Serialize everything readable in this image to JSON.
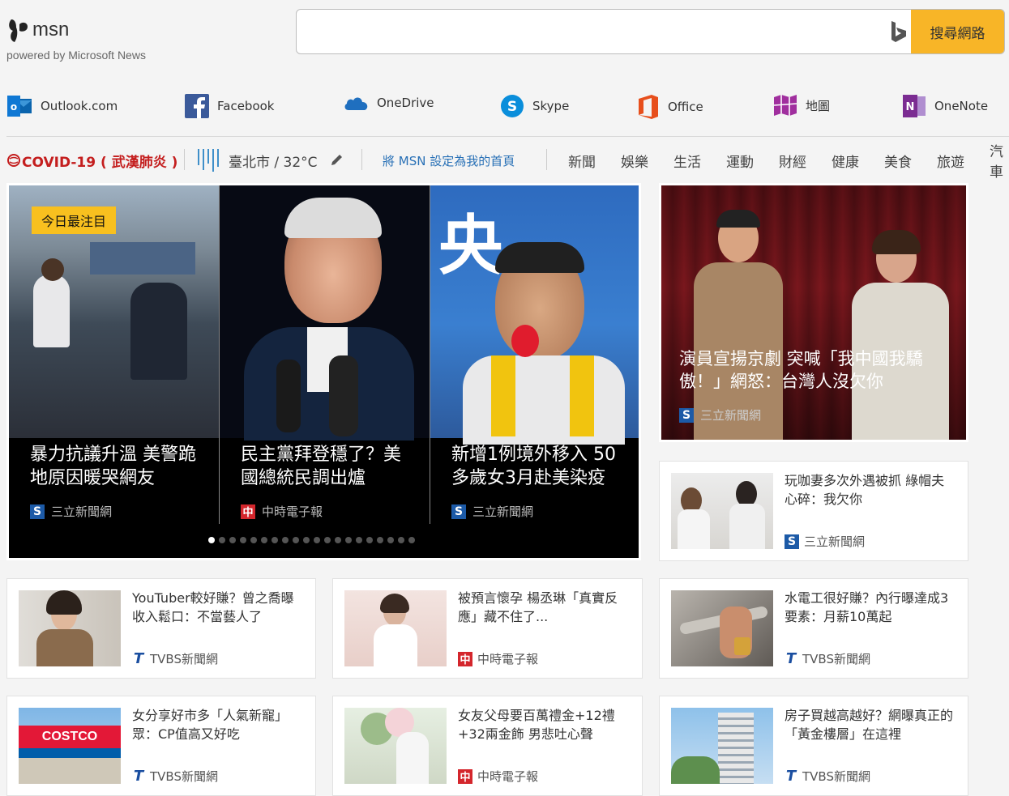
{
  "header": {
    "logo_text": "msn",
    "logo_sub": "powered by Microsoft News",
    "search_placeholder": "",
    "search_button": "搜尋網路"
  },
  "apps": [
    {
      "label": "Outlook.com",
      "icon": "outlook-icon"
    },
    {
      "label": "Facebook",
      "icon": "facebook-icon"
    },
    {
      "label": "OneDrive",
      "icon": "onedrive-icon"
    },
    {
      "label": "Skype",
      "icon": "skype-icon"
    },
    {
      "label": "Office",
      "icon": "office-icon"
    },
    {
      "label": "地圖",
      "icon": "maps-icon"
    },
    {
      "label": "OneNote",
      "icon": "onenote-icon"
    }
  ],
  "nav": {
    "covid": "COVID-19 ( 武漢肺炎 )",
    "weather": "臺北市 / 32°C",
    "set_home": "將 MSN 設定為我的首頁",
    "categories": [
      "新聞",
      "娛樂",
      "生活",
      "運動",
      "財經",
      "健康",
      "美食",
      "旅遊",
      "汽車"
    ]
  },
  "carousel": {
    "badge": "今日最注目",
    "slides": [
      {
        "title": "暴力抗議升溫 美警跪地原因暖哭網友",
        "source": "三立新聞網"
      },
      {
        "title": "民主黨拜登穩了？美國總統民調出爐",
        "source": "中時電子報"
      },
      {
        "title": "新增1例境外移入 50多歲女3月赴美染疫",
        "source": "三立新聞網"
      }
    ],
    "dot_count": 20,
    "active_dot": 0
  },
  "feature": {
    "title": "演員宣揚京劇 突喊「我中國我驕傲！」網怒：台灣人沒欠你",
    "source": "三立新聞網"
  },
  "cards": [
    {
      "title": "玩咖妻多次外遇被抓 綠帽夫心碎：我欠你",
      "source": "三立新聞網"
    },
    {
      "title": "YouTuber較好賺？曾之喬曝收入鬆口：不當藝人了",
      "source": "TVBS新聞網"
    },
    {
      "title": "被預言懷孕 楊丞琳「真實反應」藏不住了...",
      "source": "中時電子報"
    },
    {
      "title": "水電工很好賺？內行曝達成3要素：月薪10萬起",
      "source": "TVBS新聞網"
    },
    {
      "title": "女分享好市多「人氣新寵」眾：CP值高又好吃",
      "source": "TVBS新聞網"
    },
    {
      "title": "女友父母要百萬禮金+12禮+32兩金飾 男悲吐心聲",
      "source": "中時電子報"
    },
    {
      "title": "房子買越高越好？網曝真正的「黃金樓層」在這裡",
      "source": "TVBS新聞網"
    }
  ],
  "costco_label": "COSTCO"
}
